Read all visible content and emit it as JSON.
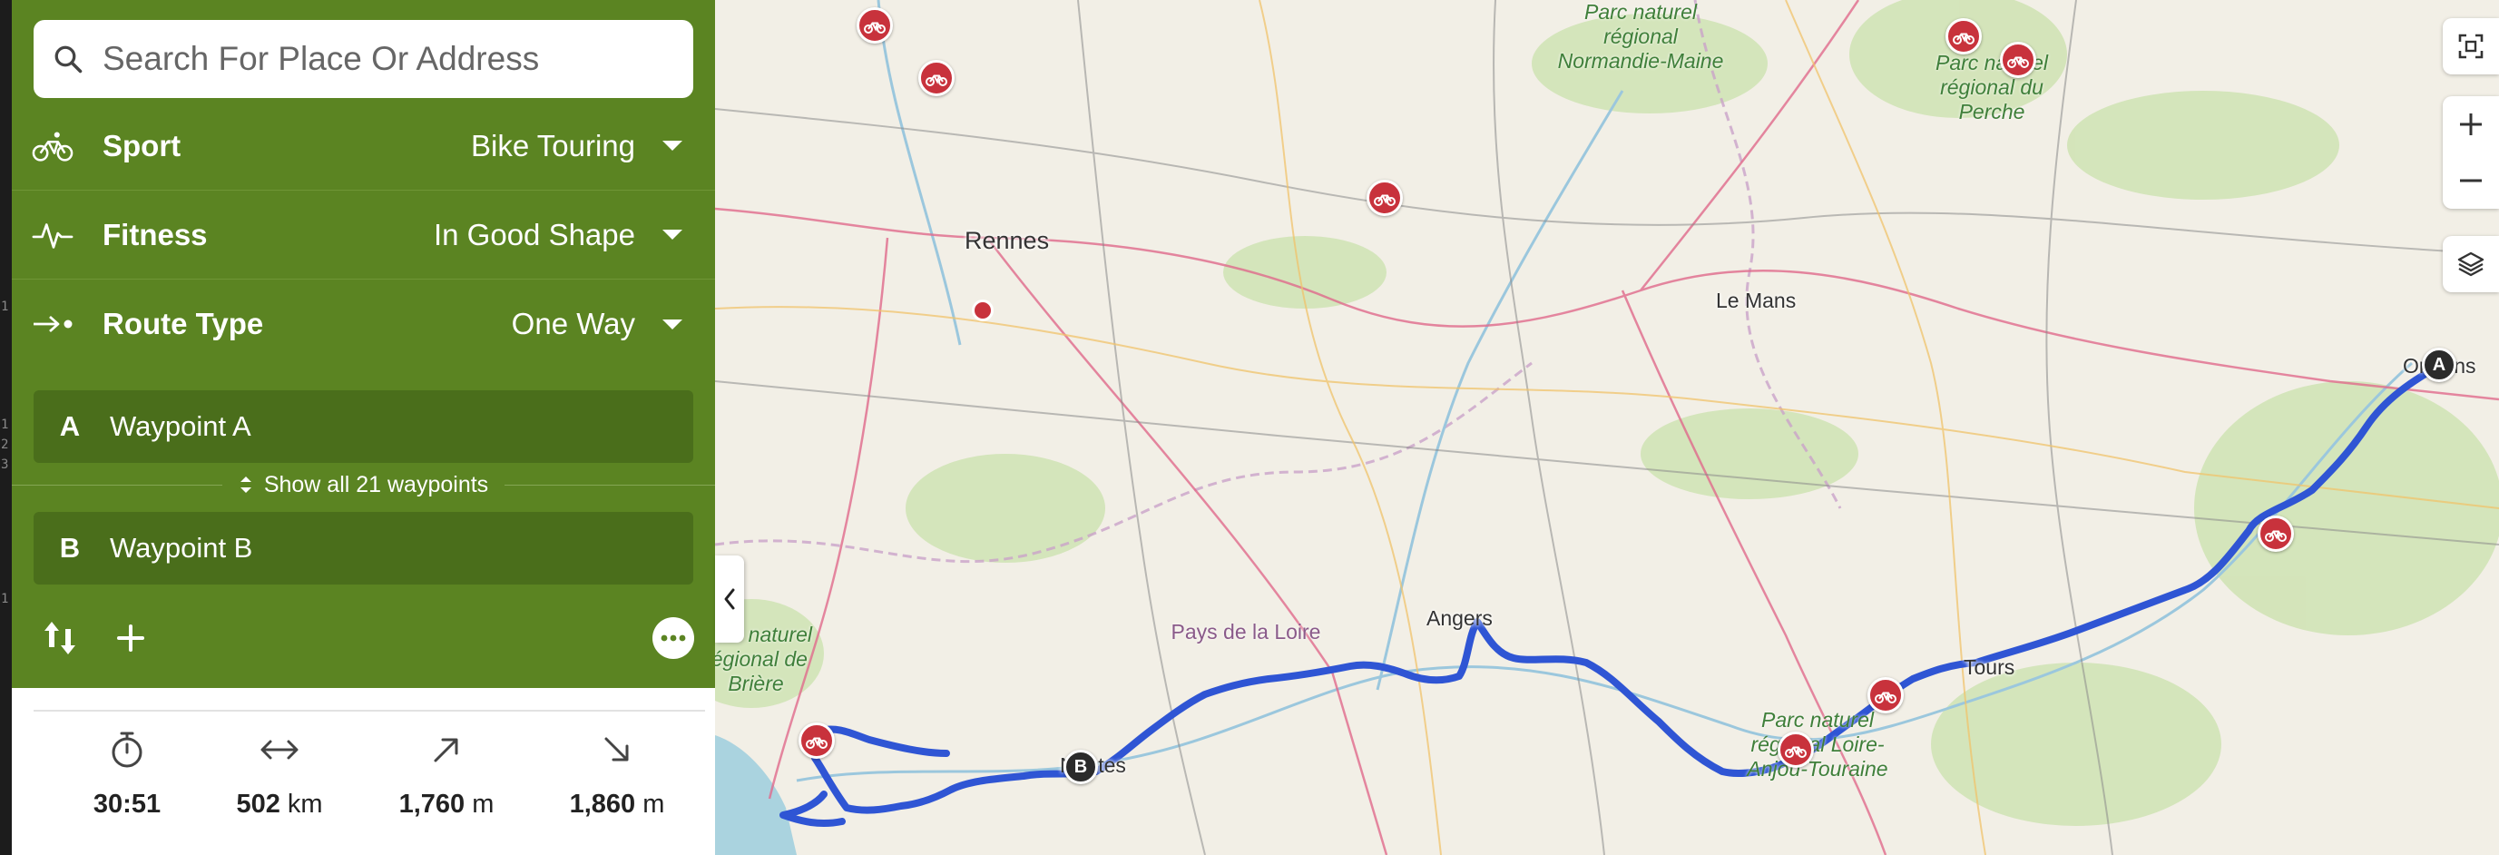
{
  "search": {
    "placeholder": "Search For Place Or Address"
  },
  "settings": [
    {
      "icon": "bike-icon",
      "label": "Sport",
      "value": "Bike Touring"
    },
    {
      "icon": "pulse-icon",
      "label": "Fitness",
      "value": "In Good Shape"
    },
    {
      "icon": "route-type-icon",
      "label": "Route Type",
      "value": "One Way"
    }
  ],
  "waypoints": {
    "start": {
      "letter": "A",
      "name": "Waypoint A"
    },
    "end": {
      "letter": "B",
      "name": "Waypoint B"
    },
    "show_all_label": "Show all 21 waypoints"
  },
  "tools": {
    "swap_icon": "swap-icon",
    "add_icon": "plus-icon",
    "more_icon": "more-icon"
  },
  "stats": {
    "duration": {
      "icon": "stopwatch-icon",
      "value": "30:51",
      "unit": ""
    },
    "distance": {
      "icon": "horizontal-arrows-icon",
      "value": "502",
      "unit": "km"
    },
    "elevation_up": {
      "icon": "arrow-up-right-icon",
      "value": "1,760",
      "unit": "m"
    },
    "elevation_down": {
      "icon": "arrow-down-right-icon",
      "value": "1,860",
      "unit": "m"
    }
  },
  "map": {
    "cities": [
      "Rennes",
      "Le Mans",
      "Angers",
      "Nantes",
      "Tours",
      "Orléans"
    ],
    "regions": [
      "Pays de la Loire"
    ],
    "parks": [
      "Parc naturel régional Normandie-Maine",
      "Parc naturel régional du Perche",
      "Parc naturel régional de Brière",
      "Parc naturel régional Loire-Anjou-Touraine"
    ],
    "markers": {
      "start": "A",
      "end": "B"
    },
    "route_color": "#2f55d4",
    "poi_color": "#c8323c"
  },
  "map_controls": [
    "fullscreen-icon",
    "zoom-in-icon",
    "zoom-out-icon",
    "layers-icon"
  ],
  "colors": {
    "panel_green": "#5b8422",
    "field_green": "#4a6e1b"
  }
}
